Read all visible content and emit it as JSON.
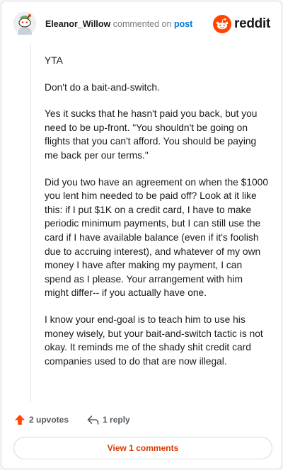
{
  "comment": {
    "username": "Eleanor_Willow",
    "verb": "commented on",
    "post_link": "post",
    "paragraphs": [
      "YTA",
      "Don't do a bait-and-switch.",
      "Yes it sucks that he hasn't paid you back, but you need to be up-front. \"You shouldn't be going on flights that you can't afford. You should be paying me back per our terms.\"",
      "Did you two have an agreement on when the $1000 you lent him needed to be paid off? Look at it like this: if I put $1K on a credit card, I have to make periodic minimum payments, but I can still use the card if I have available balance (even if it's foolish due to accruing interest), and whatever of my own money I have after making my payment, I can spend as I please. Your arrangement with him might differ-- if you actually have one.",
      "I know your end-goal is to teach him to use his money wisely, but your bait-and-switch tactic is not okay. It reminds me of the shady shit credit card companies used to do that are now illegal."
    ]
  },
  "brand": {
    "name": "reddit",
    "color": "#ff4500"
  },
  "actions": {
    "upvotes": "2 upvotes",
    "reply": "1 reply",
    "view_comments": "View 1 comments"
  },
  "icons": {
    "avatar": "snoo-avatar-icon",
    "logo": "reddit-logo-icon",
    "upvote": "upvote-arrow-icon",
    "reply": "reply-arrow-icon"
  },
  "colors": {
    "accent": "#ff4500",
    "link": "#0079d3",
    "view_button_text": "#d93a00"
  }
}
